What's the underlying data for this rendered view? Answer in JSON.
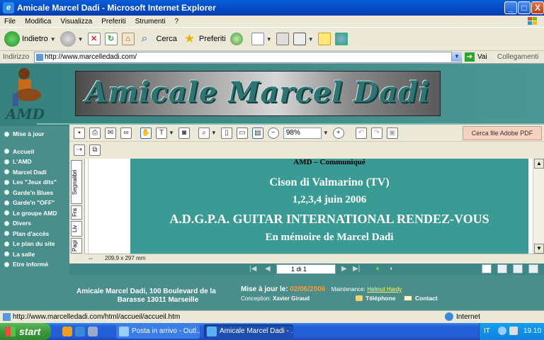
{
  "window": {
    "title": "Amicale Marcel Dadi - Microsoft Internet Explorer",
    "buttons": {
      "minimize": "_",
      "maximize": "□",
      "close": "X"
    }
  },
  "menu": [
    "File",
    "Modifica",
    "Visualizza",
    "Preferiti",
    "Strumenti",
    "?"
  ],
  "toolbar": {
    "back_label": "Indietro",
    "search_label": "Cerca",
    "favorites_label": "Preferiti"
  },
  "address": {
    "label": "Indirizzo",
    "url": "http://www.marcelledadi.com/",
    "go_label": "Vai",
    "links_label": "Collegamenti"
  },
  "site": {
    "banner_title": "Amicale Marcel Dadi",
    "logo_text": "AMD",
    "nav_top": "Mise à jour",
    "nav": [
      "Accueil",
      "L'AMD",
      "Marcel Dadi",
      "Les \"Jeux dits\"",
      "Garde'n Blues",
      "Garde'n \"OFF\"",
      "Le groupe AMD",
      "Divers",
      "Plan d'accès",
      "Le plan du site",
      "La salle",
      "Etre informé"
    ]
  },
  "pdf": {
    "zoom": "98%",
    "search_button": "Cerca file Adobe PDF",
    "side_tabs": [
      "Segnalibri",
      "Fra",
      "Liv",
      "Pagi"
    ],
    "header": "AMD – Communiqué",
    "line1": "Cison di Valmarino (TV)",
    "line2": "1,2,3,4 juin 2006",
    "line3": "A.D.G.P.A. GUITAR INTERNATIONAL RENDEZ-VOUS",
    "line4": "En mémoire de Marcel Dadi",
    "page_size": "209,9 x 297 mm",
    "page_indicator": "1 di 1"
  },
  "footer": {
    "address_line1": "Amicale Marcel Dadi, 100 Boulevard de la",
    "address_line2": "Barasse 13011 Marseille",
    "update_label": "Mise à jour le:",
    "update_date": "02/06/2006",
    "maint_label": "Maintenance:",
    "maint_name": "Helmut Hardy",
    "concept_label": "Conception:",
    "concept_name": "Xavier Giraud",
    "telephone": "Téléphone",
    "contact": "Contact"
  },
  "status": {
    "url": "http://www.marcelledadi.com/html/accueil/accueil.htm",
    "zone": "Internet"
  },
  "taskbar": {
    "start": "start",
    "tasks": [
      "Posta in arrivo - Outl...",
      "Amicale Marcel Dadi - ..."
    ],
    "lang": "IT",
    "clock": "19.10"
  },
  "colors": {
    "page_bg": "#4a8e8c",
    "pdf_page_bg": "#3a9a94",
    "update_date": "#ff9a2e",
    "xp_blue": "#0348c2"
  }
}
